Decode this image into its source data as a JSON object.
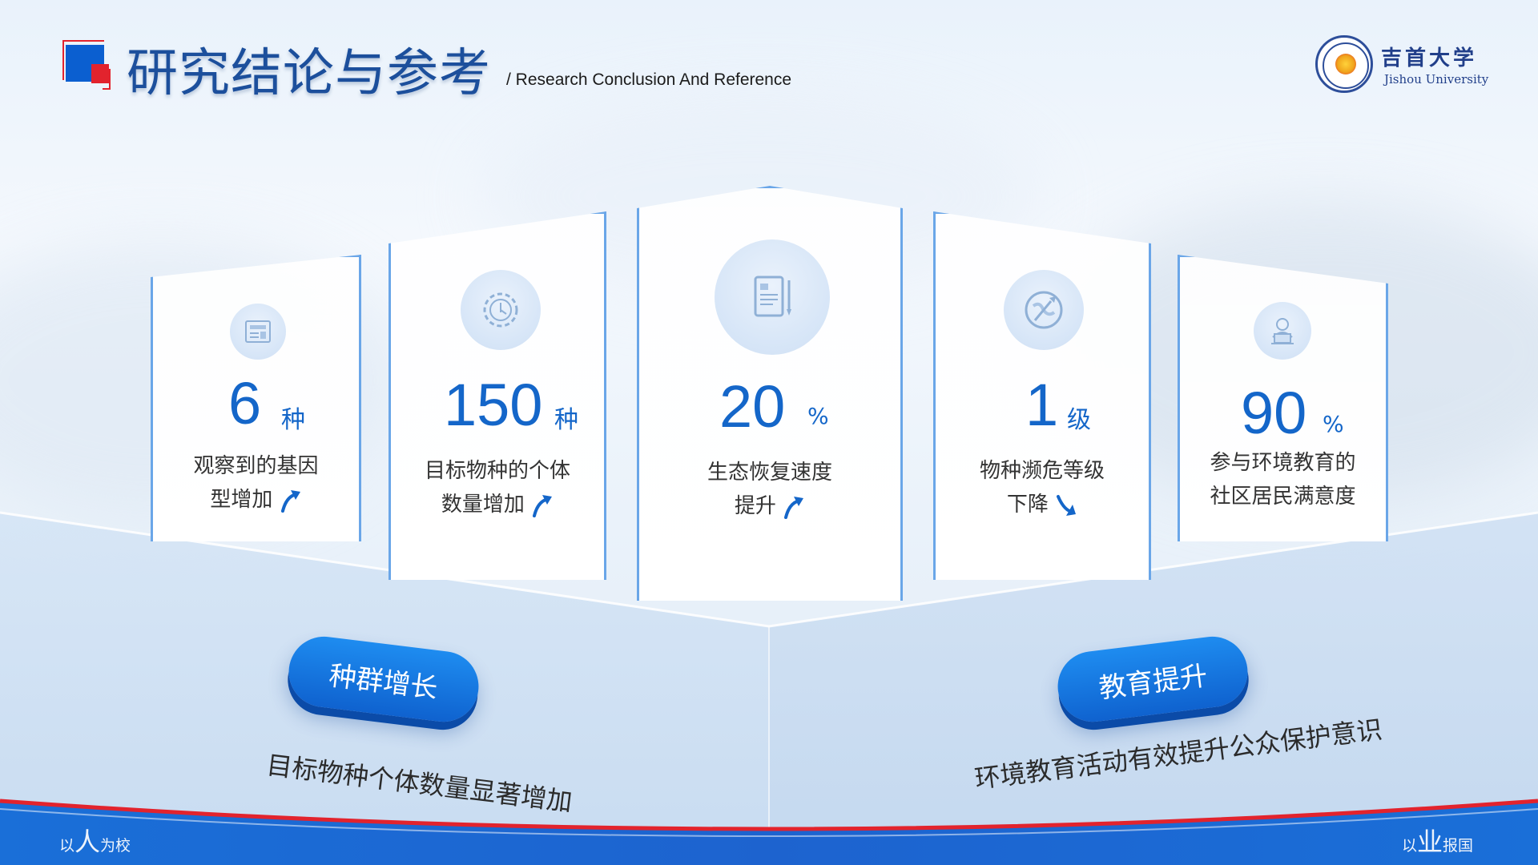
{
  "header": {
    "title": "研究结论与参考",
    "subtitle": "/ Research Conclusion  And Reference",
    "university_cn": "吉首大学",
    "university_en": "Jishou University"
  },
  "cards": [
    {
      "icon": "newspaper-icon",
      "number": "6",
      "unit": "种",
      "desc_lines": [
        "观察到的基因",
        "型增加"
      ],
      "trend": "up"
    },
    {
      "icon": "gear-icon",
      "number": "150",
      "unit": "种",
      "desc_lines": [
        "目标物种的个体",
        "数量增加"
      ],
      "trend": "up"
    },
    {
      "icon": "document-pen-icon",
      "number": "20",
      "unit": "%",
      "desc_lines": [
        "生态恢复速度",
        "提升"
      ],
      "trend": "up"
    },
    {
      "icon": "globe-rocket-icon",
      "number": "1",
      "unit": "级",
      "desc_lines": [
        "物种濒危等级",
        "下降"
      ],
      "trend": "down"
    },
    {
      "icon": "person-laptop-icon",
      "number": "90",
      "unit": "%",
      "desc_lines": [
        "参与环境教育的",
        "社区居民满意度"
      ],
      "trend": "none"
    }
  ],
  "highlights": [
    {
      "label": "种群增长",
      "caption": "目标物种个体数量显著增加"
    },
    {
      "label": "教育提升",
      "caption": "环境教育活动有效提升公众保护意识"
    }
  ],
  "footer": {
    "left_motto": {
      "pre": "以",
      "big": "人",
      "post": "为校"
    },
    "right_motto": {
      "pre": "以",
      "big": "业",
      "post": "报国"
    }
  },
  "colors": {
    "accent_blue": "#1466c9",
    "accent_red": "#e2232d",
    "card_border": "#6aa6e8"
  }
}
